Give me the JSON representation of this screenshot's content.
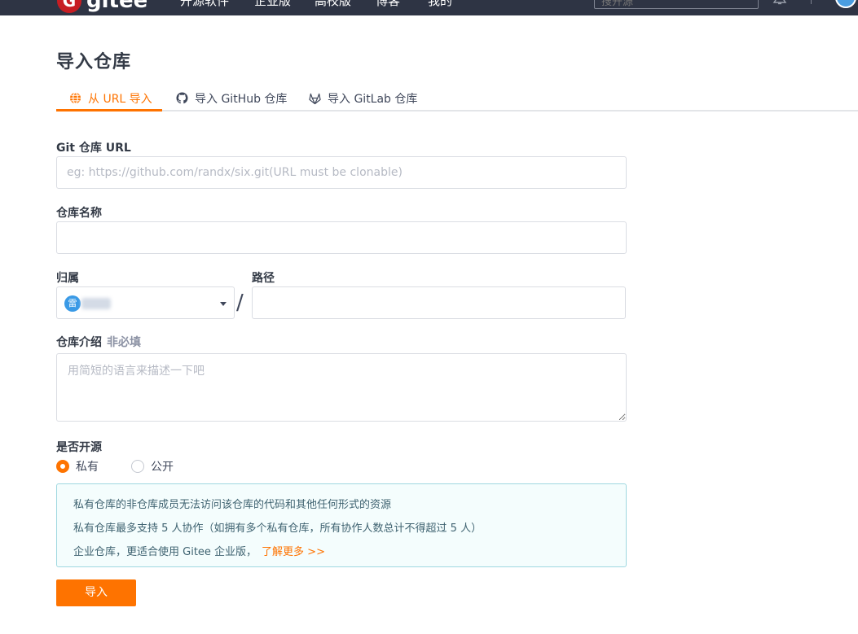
{
  "topnav": {
    "logo_mark": "G",
    "logo_text": "gitee",
    "items": [
      "开源软件",
      "企业版",
      "高校版",
      "博客",
      "我的"
    ],
    "search_placeholder": "搜开源"
  },
  "page": {
    "title": "导入仓库"
  },
  "tabs": [
    {
      "label": "从 URL 导入",
      "icon": "globe-icon",
      "active": true
    },
    {
      "label": "导入 GitHub 仓库",
      "icon": "github-icon",
      "active": false
    },
    {
      "label": "导入 GitLab 仓库",
      "icon": "gitlab-icon",
      "active": false
    }
  ],
  "form": {
    "git_url": {
      "label": "Git 仓库 URL",
      "placeholder": "eg: https://github.com/randx/six.git(URL must be clonable)",
      "value": ""
    },
    "repo_name": {
      "label": "仓库名称",
      "value": ""
    },
    "owner": {
      "label": "归属",
      "avatar_text": "雷"
    },
    "path": {
      "label": "路径",
      "value": ""
    },
    "separator": "/",
    "description": {
      "label": "仓库介绍",
      "optional": "非必填",
      "placeholder": "用简短的语言来描述一下吧"
    },
    "visibility": {
      "label": "是否开源",
      "options": [
        {
          "label": "私有",
          "checked": true
        },
        {
          "label": "公开",
          "checked": false
        }
      ]
    },
    "notice": {
      "line1": "私有仓库的非仓库成员无法访问该仓库的代码和其他任何形式的资源",
      "line2": "私有仓库最多支持 5 人协作（如拥有多个私有仓库，所有协作人数总计不得超过 5 人）",
      "line3": "企业仓库，更适合使用 Gitee 企业版，",
      "link": "了解更多 >>"
    },
    "submit_label": "导入"
  },
  "colors": {
    "accent": "#fe7300",
    "nav_bg": "#2e3444",
    "notice_bg": "#f4fdfd",
    "notice_border": "#9fd8e0"
  }
}
